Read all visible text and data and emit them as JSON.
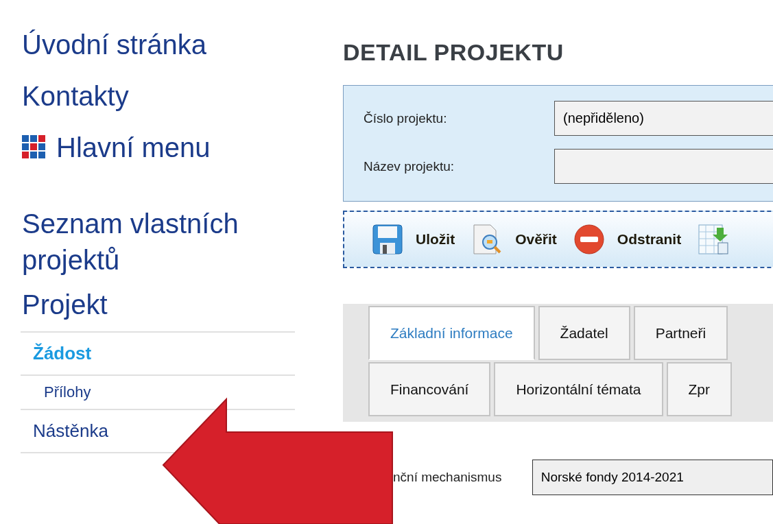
{
  "top_links": [
    {
      "label": "Úvodní stránka",
      "kind": "plain"
    },
    {
      "label": "Kontakty",
      "kind": "plain"
    },
    {
      "label": "Hlavní menu",
      "kind": "menu"
    }
  ],
  "project_links": [
    {
      "label": "Seznam vlastních projektů"
    },
    {
      "label": "Projekt"
    }
  ],
  "project_menu": [
    {
      "label": "Žádost",
      "selected": true,
      "children": [
        {
          "label": "Přílohy",
          "selected": false
        }
      ]
    },
    {
      "label": "Nástěnka",
      "selected": false
    }
  ],
  "page_title": "DETAIL PROJEKTU",
  "project_form": {
    "fields": [
      {
        "label": "Číslo projektu:",
        "value": "(nepřiděleno)"
      },
      {
        "label": "Název projektu:"
      }
    ]
  },
  "toolbar": [
    {
      "kind": "save",
      "label": "Uložit"
    },
    {
      "kind": "verify",
      "label": "Ověřit"
    },
    {
      "kind": "delete",
      "label": "Odstranit"
    },
    {
      "kind": "export"
    }
  ],
  "tab_rows": [
    {
      "tabs": [
        {
          "label": "Základní informace",
          "selected": true
        },
        {
          "label": "Žadatel",
          "selected": false
        },
        {
          "label": "Partneři",
          "selected": false
        }
      ]
    },
    {
      "tabs": [
        {
          "label": "Financování",
          "selected": false
        },
        {
          "label": "Horizontální témata",
          "selected": false
        },
        {
          "label": "Zpr",
          "selected": false
        }
      ]
    }
  ],
  "detail_fields": [
    {
      "label": "nční mechanismus",
      "value": "Norské fondy 2014-2021"
    }
  ]
}
